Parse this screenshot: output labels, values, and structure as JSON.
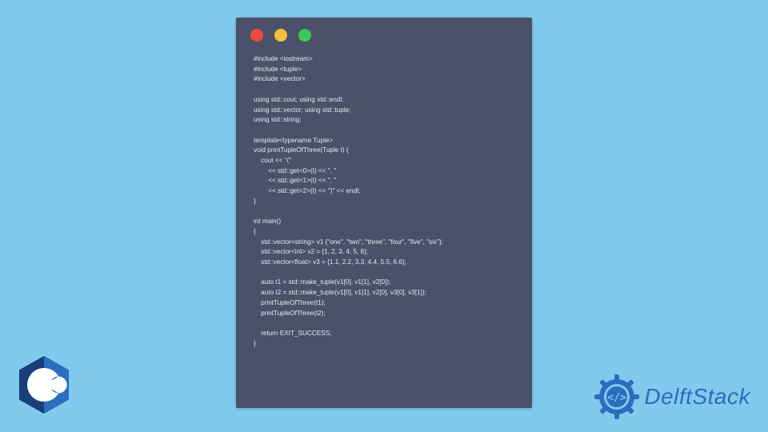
{
  "window": {
    "traffic": [
      "red",
      "yellow",
      "green"
    ]
  },
  "code": "#include <iostream>\n#include <tuple>\n#include <vector>\n\nusing std::cout; using std::endl;\nusing std::vector; using std::tuple;\nusing std::string;\n\ntemplate<typename Tuple>\nvoid printTupleOfThree(Tuple t) {\n    cout << \"(\"\n        << std::get<0>(t) << \", \"\n        << std::get<1>(t) << \", \"\n        << std::get<2>(t) << \")\" << endl;\n}\n\nint main()\n{\n    std::vector<string> v1 {\"one\", \"two\", \"three\", \"four\", \"five\", \"six\"};\n    std::vector<int> v2 = {1, 2, 3, 4, 5, 6};\n    std::vector<float> v3 = {1.1, 2.2, 3.3, 4.4, 5.5, 6.6};\n\n    auto t1 = std::make_tuple(v1[0], v1[1], v2[0]);\n    auto t2 = std::make_tuple(v1[0], v1[1], v2[0], v3[0], v3[1]);\n    printTupleOfThree(t1);\n    printTupleOfThree(t2);\n\n    return EXIT_SUCCESS;\n}",
  "cpp_badge": {
    "label": "C++"
  },
  "brand": {
    "name": "DelftStack"
  }
}
